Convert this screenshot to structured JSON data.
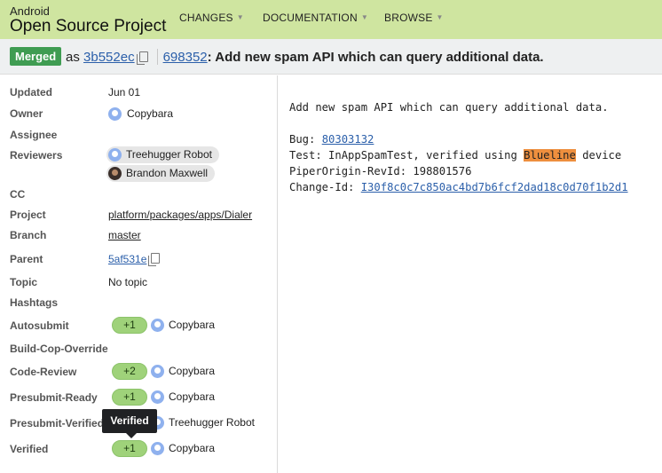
{
  "header": {
    "brand_small": "Android",
    "brand_big": "Open Source Project",
    "nav": [
      {
        "label": "CHANGES"
      },
      {
        "label": "DOCUMENTATION"
      },
      {
        "label": "BROWSE"
      }
    ]
  },
  "titlebar": {
    "status": "Merged",
    "as_text": "as",
    "commit_hash": "3b552ec",
    "change_number": "698352",
    "title": ": Add new spam API which can query additional data."
  },
  "info": {
    "updated_label": "Updated",
    "updated_value": "Jun 01",
    "owner_label": "Owner",
    "owner_value": "Copybara",
    "assignee_label": "Assignee",
    "reviewers_label": "Reviewers",
    "reviewers": [
      "Treehugger Robot",
      "Brandon Maxwell"
    ],
    "cc_label": "CC",
    "project_label": "Project",
    "project_value": "platform/packages/apps/Dialer",
    "branch_label": "Branch",
    "branch_value": "master",
    "parent_label": "Parent",
    "parent_value": "5af531e",
    "topic_label": "Topic",
    "topic_value": "No topic",
    "hashtags_label": "Hashtags"
  },
  "labels": [
    {
      "name": "Autosubmit",
      "vote": "+1",
      "voter": "Copybara"
    },
    {
      "name": "Build-Cop-Override",
      "vote": "",
      "voter": ""
    },
    {
      "name": "Code-Review",
      "vote": "+2",
      "voter": "Copybara"
    },
    {
      "name": "Presubmit-Ready",
      "vote": "+1",
      "voter": "Copybara"
    },
    {
      "name": "Presubmit-Verified",
      "vote": "",
      "voter": "Treehugger Robot"
    },
    {
      "name": "Verified",
      "vote": "+1",
      "voter": "Copybara"
    }
  ],
  "tooltip": "Verified",
  "commit_message": {
    "subject": "Add new spam API which can query additional data.",
    "bug_prefix": "Bug: ",
    "bug_id": "80303132",
    "test_prefix": "Test: InAppSpamTest, verified using ",
    "test_highlight": "Blueline",
    "test_suffix": " device",
    "piper": "PiperOrigin-RevId: 198801576",
    "change_id_prefix": "Change-Id: ",
    "change_id": "I30f8c0c7c850ac4bd7b6fcf2dad18c0d70f1b2d1"
  },
  "colors": {
    "header_bg": "#cfe5a0",
    "merged_badge": "#3f9c52",
    "vote_chip": "#9fd27a",
    "highlight": "#ee8f3e",
    "link": "#2b5faa"
  }
}
